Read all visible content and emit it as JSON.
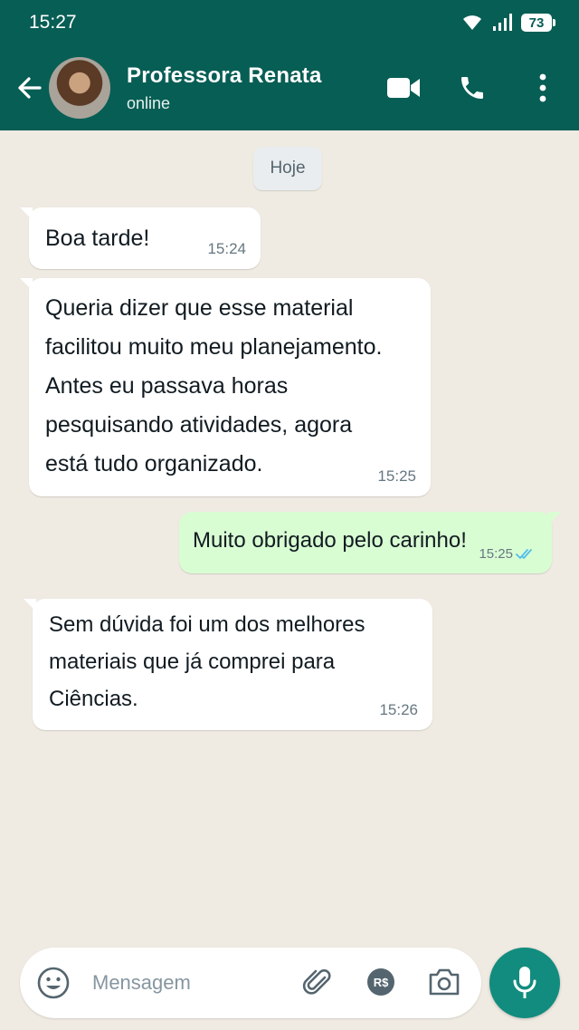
{
  "status_bar": {
    "time": "15:27",
    "battery": "73"
  },
  "header": {
    "contact_name": "Professora Renata",
    "status": "online"
  },
  "day_divider": "Hoje",
  "messages": [
    {
      "direction": "in",
      "text": "Boa tarde!",
      "time": "15:24"
    },
    {
      "direction": "in",
      "lines": [
        "Queria dizer que esse material",
        "facilitou muito meu planejamento.",
        "Antes eu passava horas",
        "pesquisando atividades, agora",
        "está tudo organizado."
      ],
      "time": "15:25"
    },
    {
      "direction": "out",
      "text": "Muito obrigado pelo carinho!",
      "time": "15:25",
      "read": true
    },
    {
      "direction": "in",
      "lines": [
        "Sem dúvida foi um dos melhores",
        "materiais que já comprei para",
        "Ciências."
      ],
      "time": "15:26"
    }
  ],
  "composer": {
    "placeholder": "Mensagem",
    "payment_label": "R$"
  },
  "colors": {
    "header": "#075e54",
    "background": "#efeae2",
    "outgoing_bubble": "#d9fdd3",
    "mic_button": "#128c7e",
    "read_ticks": "#53bdeb"
  },
  "icons": [
    "back-arrow-icon",
    "video-call-icon",
    "voice-call-icon",
    "more-options-icon",
    "emoji-icon",
    "attach-icon",
    "payment-icon",
    "camera-icon",
    "mic-icon",
    "read-ticks-icon",
    "wifi-icon",
    "signal-icon"
  ]
}
